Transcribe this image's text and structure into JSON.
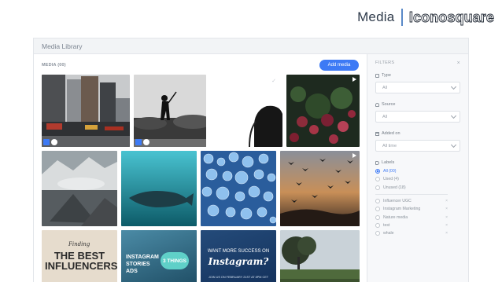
{
  "slide": {
    "section": "Media",
    "brand": "Iconosquare"
  },
  "window": {
    "title": "Media Library"
  },
  "library": {
    "media_count": "MEDIA (00)",
    "add_button": "Add media",
    "thumbnails": [
      {
        "name": "city-street-photo"
      },
      {
        "name": "golfer-silhouette-photo"
      },
      {
        "name": "face-profile-photo"
      },
      {
        "name": "flower-bush-video"
      },
      {
        "name": "mountain-lake-photo"
      },
      {
        "name": "underwater-whale-photo"
      },
      {
        "name": "water-droplets-photo"
      },
      {
        "name": "birds-sunset-video"
      },
      {
        "name": "best-influencers-graphic",
        "text_small": "Finding",
        "text_big": "THE BEST INFLUENCERS"
      },
      {
        "name": "instagram-stories-ads-graphic",
        "text_main": "INSTAGRAM STORIES ADS",
        "text_badge": "3 THINGS"
      },
      {
        "name": "success-on-instagram-graphic",
        "text_main": "WANT MORE SUCCESS ON",
        "text_script": "Instagram?",
        "text_bottom": "JOIN US ON FEBRUARY 21ST AT 8PM CET"
      },
      {
        "name": "landscape-trees-photo"
      }
    ]
  },
  "filters": {
    "title": "FILTERS",
    "close": "×",
    "type": {
      "label": "Type",
      "value": "All"
    },
    "source": {
      "label": "Source",
      "value": "All"
    },
    "added_on": {
      "label": "Added on",
      "value": "All time"
    },
    "labels": {
      "label": "Labels",
      "options": [
        "All (00)",
        "Used (4)",
        "Unused (18)"
      ],
      "items": [
        "Influencer UGC",
        "Instagram Marketing",
        "Nature media",
        "test",
        "whale"
      ]
    }
  },
  "colors": {
    "accent": "#3d7af5",
    "brand_divider": "#5a89c8"
  }
}
